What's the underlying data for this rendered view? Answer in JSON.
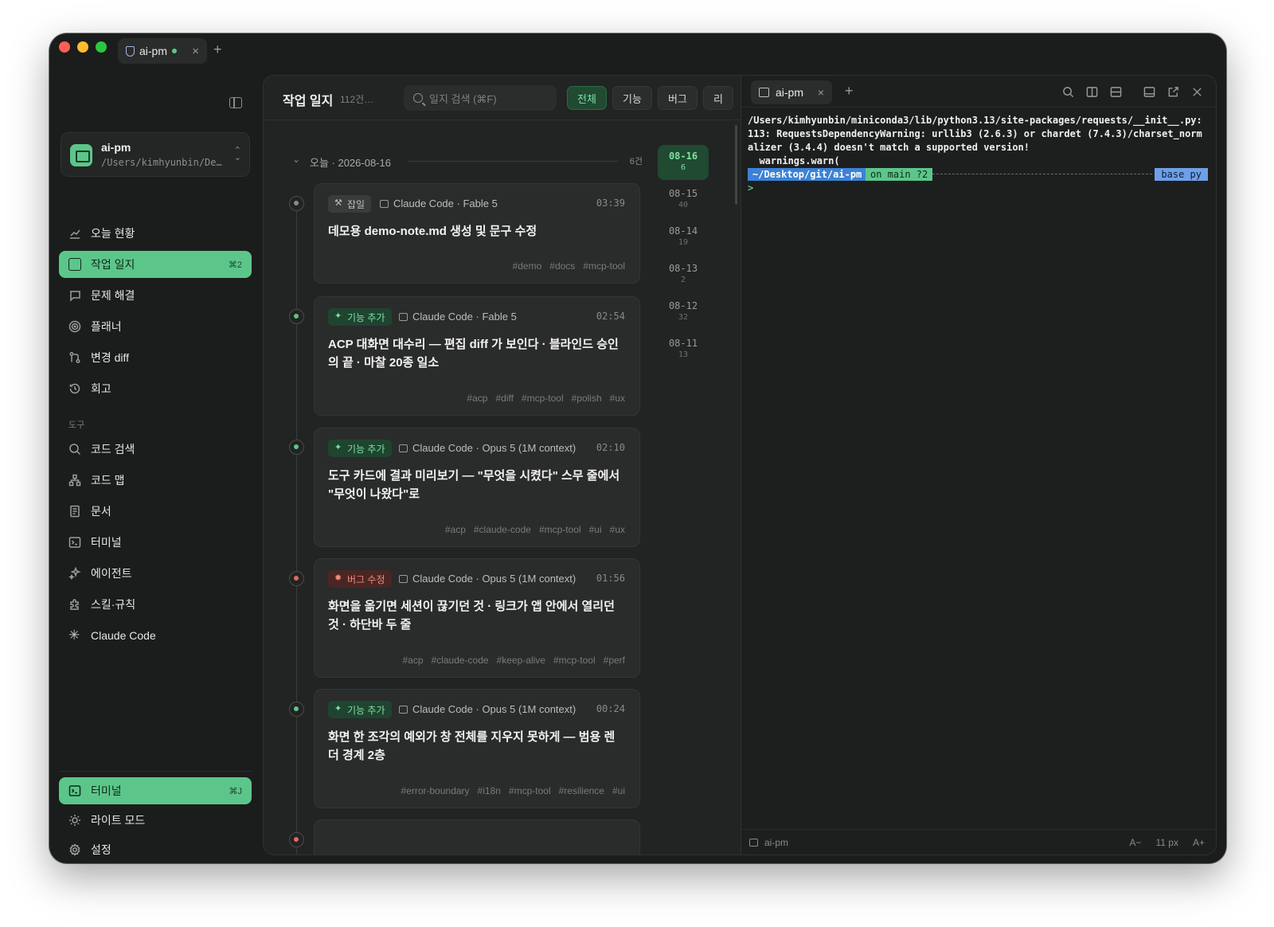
{
  "window_tab": {
    "title": "ai-pm"
  },
  "sidebar": {
    "project": {
      "name": "ai-pm",
      "path": "/Users/kimhyunbin/De…"
    },
    "items": [
      {
        "label": "오늘 현황",
        "icon": "chart-up-icon"
      },
      {
        "label": "작업 일지",
        "icon": "journal-icon",
        "shortcut": "⌘2",
        "active": true
      },
      {
        "label": "문제 해결",
        "icon": "chat-icon"
      },
      {
        "label": "플래너",
        "icon": "target-icon"
      },
      {
        "label": "변경 diff",
        "icon": "git-diff-icon"
      },
      {
        "label": "회고",
        "icon": "history-icon"
      }
    ],
    "tools_label": "도구",
    "tools": [
      {
        "label": "코드 검색",
        "icon": "search-icon"
      },
      {
        "label": "코드 맵",
        "icon": "code-map-icon"
      },
      {
        "label": "문서",
        "icon": "document-icon"
      },
      {
        "label": "터미널",
        "icon": "terminal-icon"
      },
      {
        "label": "에이전트",
        "icon": "sparkle-icon"
      },
      {
        "label": "스킬·규칙",
        "icon": "puzzle-icon"
      },
      {
        "label": "Claude Code",
        "icon": "claude-icon"
      }
    ],
    "bottom": [
      {
        "label": "터미널",
        "icon": "terminal-icon",
        "shortcut": "⌘J",
        "active": true
      },
      {
        "label": "라이트 모드",
        "icon": "sun-icon"
      },
      {
        "label": "설정",
        "icon": "gear-icon"
      }
    ]
  },
  "journal": {
    "title": "작업 일지",
    "count": "112건…",
    "search_placeholder": "일지 검색 (⌘F)",
    "filters": [
      "전체",
      "기능",
      "버그",
      "리"
    ],
    "day_label": "오늘 · 2026-08-16",
    "day_count": "6건",
    "entries": [
      {
        "type": "chore",
        "badge": "잡일",
        "agent": "Claude Code · Fable 5",
        "time": "03:39",
        "title": "데모용 demo-note.md 생성 및 문구 수정",
        "tags": [
          "#demo",
          "#docs",
          "#mcp-tool"
        ]
      },
      {
        "type": "feat",
        "badge": "기능 추가",
        "agent": "Claude Code · Fable 5",
        "time": "02:54",
        "title": "ACP 대화면 대수리 — 편집 diff 가 보인다 · 블라인드 승인의 끝 · 마찰 20종 일소",
        "tags": [
          "#acp",
          "#diff",
          "#mcp-tool",
          "#polish",
          "#ux"
        ]
      },
      {
        "type": "feat",
        "badge": "기능 추가",
        "agent": "Claude Code · Opus 5 (1M context)",
        "time": "02:10",
        "title": "도구 카드에 결과 미리보기 — \"무엇을 시켰다\" 스무 줄에서 \"무엇이 나왔다\"로",
        "tags": [
          "#acp",
          "#claude-code",
          "#mcp-tool",
          "#ui",
          "#ux"
        ]
      },
      {
        "type": "bug",
        "badge": "버그 수정",
        "agent": "Claude Code · Opus 5 (1M context)",
        "time": "01:56",
        "title": "화면을 옮기면 세션이 끊기던 것 · 링크가 앱 안에서 열리던 것 · 하단바 두 줄",
        "tags": [
          "#acp",
          "#claude-code",
          "#keep-alive",
          "#mcp-tool",
          "#perf"
        ]
      },
      {
        "type": "feat",
        "badge": "기능 추가",
        "agent": "Claude Code · Opus 5 (1M context)",
        "time": "00:24",
        "title": "화면 한 조각의 예외가 창 전체를 지우지 못하게 — 범용 렌더 경계 2층",
        "tags": [
          "#error-boundary",
          "#i18n",
          "#mcp-tool",
          "#resilience",
          "#ui"
        ]
      }
    ],
    "dates": [
      {
        "date": "08-16",
        "count": "6",
        "active": true
      },
      {
        "date": "08-15",
        "count": "40"
      },
      {
        "date": "08-14",
        "count": "19"
      },
      {
        "date": "08-13",
        "count": "2"
      },
      {
        "date": "08-12",
        "count": "32"
      },
      {
        "date": "08-11",
        "count": "13"
      }
    ]
  },
  "terminal": {
    "tab": "ai-pm",
    "output": "/Users/kimhyunbin/miniconda3/lib/python3.13/site-packages/requests/__init__.py:\n113: RequestsDependencyWarning: urllib3 (2.6.3) or chardet (7.4.3)/charset_norm\nalizer (3.4.4) doesn't match a supported version!\n  warnings.warn(",
    "prompt_path": "~/Desktop/git/ai-pm",
    "prompt_git": "on main ?2",
    "prompt_env": "base py",
    "caret": ">",
    "status_name": "ai-pm",
    "font_minus": "A−",
    "font_size": "11 px",
    "font_plus": "A+"
  }
}
